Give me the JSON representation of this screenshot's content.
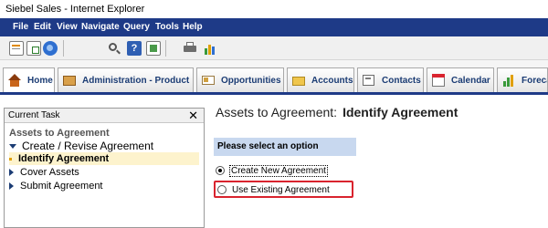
{
  "window": {
    "title": "Siebel Sales - Internet Explorer"
  },
  "menu": {
    "items": [
      {
        "label": "File"
      },
      {
        "label": "Edit"
      },
      {
        "label": "View"
      },
      {
        "label": "Navigate"
      },
      {
        "label": "Query"
      },
      {
        "label": "Tools"
      },
      {
        "label": "Help"
      }
    ]
  },
  "toolbar": {
    "icons": [
      "new-record-icon",
      "copy-record-icon",
      "refresh-icon",
      "search-icon",
      "help-icon",
      "checklist-icon",
      "print-icon",
      "chart-icon"
    ]
  },
  "tabs": [
    {
      "label": "Home",
      "icon": "home-icon",
      "active": true
    },
    {
      "label": "Administration - Product",
      "icon": "box-icon"
    },
    {
      "label": "Opportunities",
      "icon": "card-icon"
    },
    {
      "label": "Accounts",
      "icon": "folder-icon"
    },
    {
      "label": "Contacts",
      "icon": "contact-card-icon"
    },
    {
      "label": "Calendar",
      "icon": "calendar-icon"
    },
    {
      "label": "Foreca",
      "icon": "forecast-chart-icon"
    }
  ],
  "task_panel": {
    "header": "Current Task",
    "close_glyph": "✕",
    "title": "Assets to Agreement",
    "group_label": "Create / Revise Agreement",
    "current_step": "Identify Agreement",
    "steps": [
      {
        "label": "Cover Assets"
      },
      {
        "label": "Submit Agreement"
      }
    ]
  },
  "main": {
    "title_prefix": "Assets to Agreement:",
    "title_step": "Identify Agreement",
    "option_header": "Please select an option",
    "options": [
      {
        "label": "Create New Agreement",
        "selected": true
      },
      {
        "label": "Use Existing Agreement",
        "selected": false
      }
    ]
  },
  "colors": {
    "menubar": "#1e3a87",
    "highlight_box": "#d9232e",
    "option_header_bg": "#c8d8ef",
    "current_step_bg": "#fdf3cd"
  }
}
